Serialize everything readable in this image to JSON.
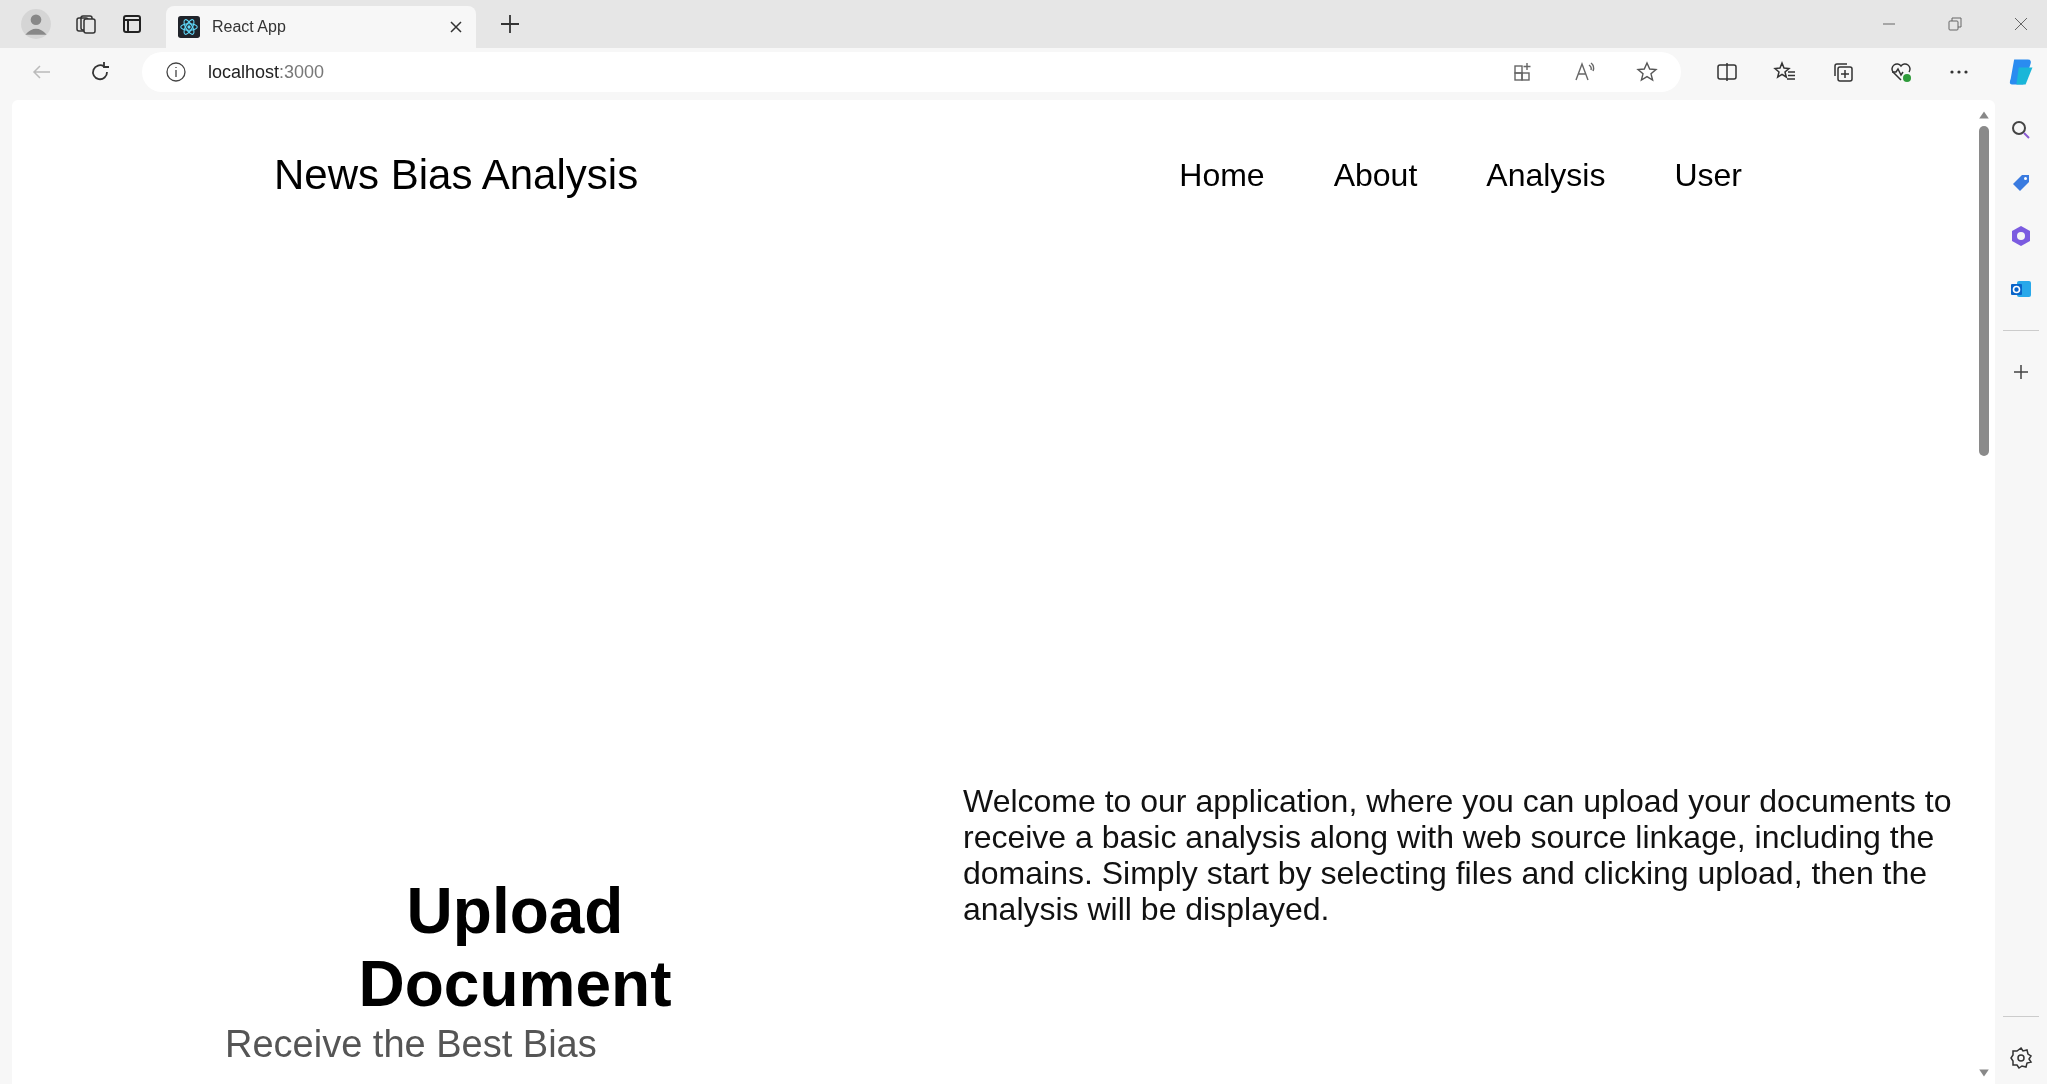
{
  "browser": {
    "tab": {
      "title": "React App"
    },
    "address": {
      "host": "localhost",
      "port": ":3000"
    }
  },
  "page": {
    "title": "News Bias Analysis",
    "nav": [
      {
        "label": "Home"
      },
      {
        "label": "About"
      },
      {
        "label": "Analysis"
      },
      {
        "label": "User"
      }
    ],
    "welcome": "Welcome to our application, where you can upload your documents to receive a basic analysis along with web source linkage, including the domains. Simply start by selecting files and clicking upload, then the analysis will be displayed.",
    "upload_heading": "Upload Document",
    "upload_subheading": "Receive the Best Bias"
  }
}
